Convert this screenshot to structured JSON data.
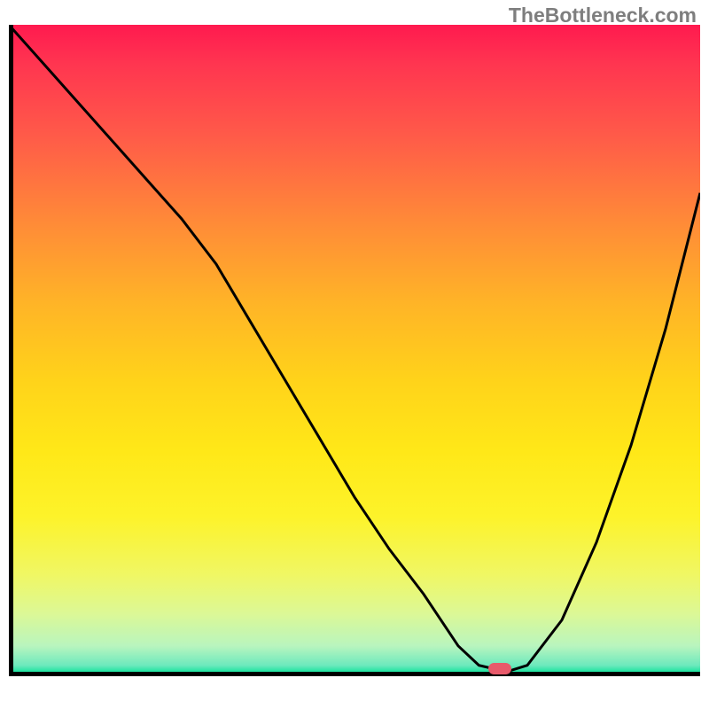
{
  "watermark": "TheBottleneck.com",
  "chart_data": {
    "type": "line",
    "title": "",
    "xlabel": "",
    "ylabel": "",
    "xlim": [
      0,
      100
    ],
    "ylim": [
      0,
      100
    ],
    "grid": false,
    "legend": false,
    "gradient_stops": [
      {
        "pos": 0,
        "color": "#ff1a4f"
      },
      {
        "pos": 0.5,
        "color": "#ffd31a"
      },
      {
        "pos": 0.85,
        "color": "#f0f764"
      },
      {
        "pos": 1.0,
        "color": "#1ee4a0"
      }
    ],
    "series": [
      {
        "name": "curve",
        "color": "#000000",
        "x": [
          0,
          5,
          10,
          15,
          20,
          25,
          30,
          35,
          40,
          45,
          50,
          55,
          60,
          65,
          68,
          72,
          75,
          80,
          85,
          90,
          95,
          100
        ],
        "y": [
          100,
          94,
          88,
          82,
          76,
          70,
          63,
          54,
          45,
          36,
          27,
          19,
          12,
          4,
          1,
          0,
          1,
          8,
          20,
          35,
          53,
          74
        ]
      }
    ],
    "marker": {
      "x": 71,
      "y": 0.6,
      "color": "#e85a6b"
    }
  }
}
